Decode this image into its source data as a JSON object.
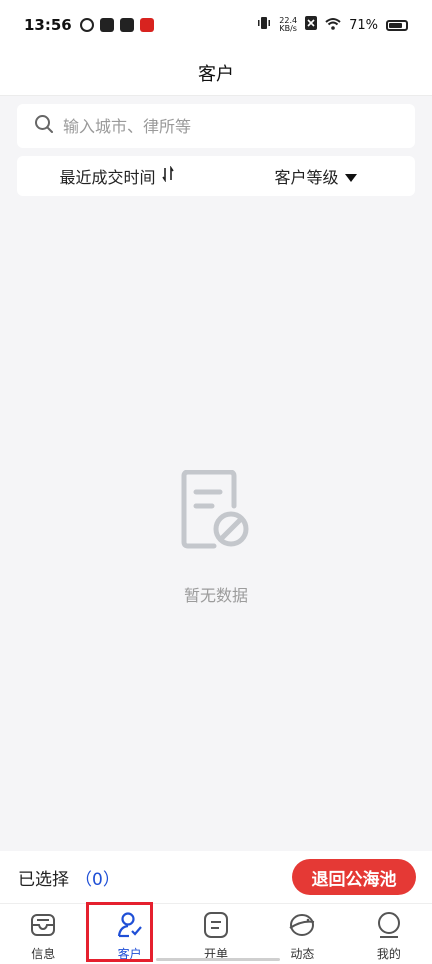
{
  "status_bar": {
    "time": "13:56",
    "net_speed_value": "22.4",
    "net_speed_unit": "KB/s",
    "battery": "71%"
  },
  "header": {
    "title": "客户"
  },
  "search": {
    "placeholder": "输入城市、律所等"
  },
  "filters": {
    "sort_label": "最近成交时间",
    "level_label": "客户等级"
  },
  "empty_state": {
    "message": "暂无数据"
  },
  "action_bar": {
    "selected_label": "已选择",
    "selected_count": "（0）",
    "return_button": "退回公海池"
  },
  "tabs": [
    {
      "label": "信息",
      "icon": "inbox-icon",
      "active": false
    },
    {
      "label": "客户",
      "icon": "user-check-icon",
      "active": true
    },
    {
      "label": "开单",
      "icon": "document-icon",
      "active": false
    },
    {
      "label": "动态",
      "icon": "planet-icon",
      "active": false
    },
    {
      "label": "我的",
      "icon": "profile-icon",
      "active": false
    }
  ],
  "colors": {
    "accent_blue": "#1f4fd6",
    "danger_red": "#e53935",
    "background": "#f5f5f7"
  }
}
